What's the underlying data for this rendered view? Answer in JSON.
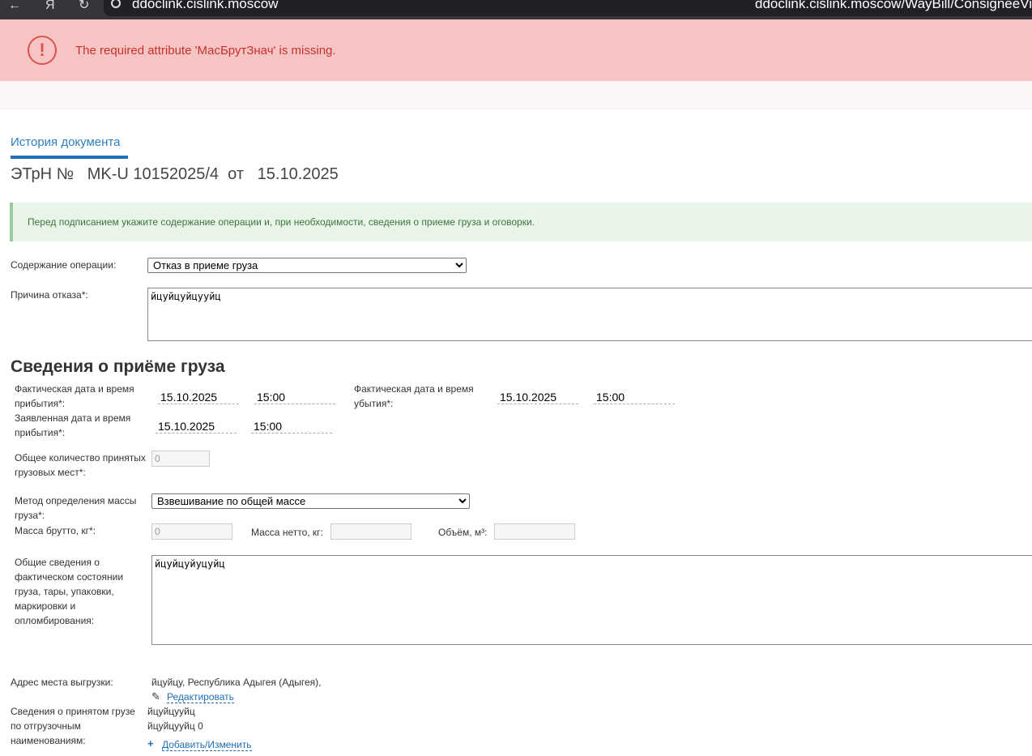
{
  "browser": {
    "url": "ddoclink.cislink.moscow",
    "url_right": "ddoclink.cislink.moscow/WayBill/ConsigneeView"
  },
  "error": {
    "icon": "exclamation-circle-icon",
    "message": "The required attribute 'МасБрутЗнач' is missing."
  },
  "tabs": {
    "history": "История документа"
  },
  "doc": {
    "title": "ЭТрН №   MK-U 10152025/4  от   15.10.2025"
  },
  "info": {
    "text": "Перед подписанием укажите содержание операции и, при необходимости, сведения о приеме груза и оговорки."
  },
  "operation": {
    "label": "Содержание операции:",
    "selected": "Отказ в приеме груза"
  },
  "refusal": {
    "label": "Причина отказа*:",
    "value": "йцуйцуйцууйц"
  },
  "cargo": {
    "section_title": "Сведения о приёме груза",
    "actual_arrival_label": "Фактическая дата и время прибытия*:",
    "actual_arrival_date": "15.10.2025",
    "actual_arrival_time": "15:00",
    "actual_departure_label": "Фактическая дата и время убытия*:",
    "actual_departure_date": "15.10.2025",
    "actual_departure_time": "15:00",
    "declared_arrival_label": "Заявленная дата и время прибытия*:",
    "declared_arrival_date": "15.10.2025",
    "declared_arrival_time": "15:00",
    "places_label": "Общее количество принятых грузовых мест*:",
    "places_value": "0",
    "mass_method_label": "Метод определения массы груза*:",
    "mass_method_selected": "Взвешивание по общей массе",
    "gross_label": "Масса брутто, кг*:",
    "gross_value": "0",
    "net_label": "Масса нетто, кг:",
    "net_value": "",
    "volume_label": "Объём, м³:",
    "volume_value": "",
    "condition_label": "Общие сведения о фактическом состоянии груза, тары, упаковки, маркировки и опломбирования:",
    "condition_value": "йцуйцуйуцуйц"
  },
  "unload": {
    "label": "Адрес места выгрузки:",
    "address": "йцуйцу, Республика Адыгея (Адыгея),",
    "edit_label": "Редактировать",
    "edit_icon": "pencil-icon"
  },
  "shipping": {
    "label": "Сведения о принятом грузе по отгрузочным наименованиям:",
    "line1": "йцуйцууйц",
    "line2": "йцуйцууйц 0",
    "add_label": "Добавить/Изменить",
    "add_icon": "plus-icon"
  }
}
